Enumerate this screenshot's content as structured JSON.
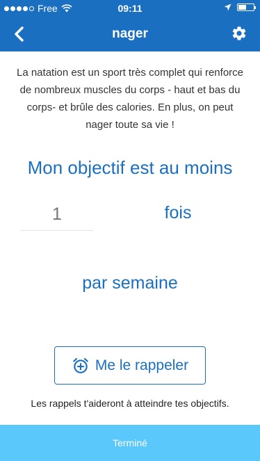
{
  "status_bar": {
    "carrier": "Free",
    "time": "09:11",
    "signal_icon": "signal-dots-icon",
    "wifi_icon": "wifi-icon",
    "location_icon": "location-arrow-icon",
    "battery_icon": "battery-icon",
    "battery_level": 0.55
  },
  "nav": {
    "title": "nager",
    "back_icon": "chevron-left-icon",
    "settings_icon": "gear-icon"
  },
  "description": "La natation est un sport très complet qui renforce de nombreux muscles du corps - haut et bas du corps- et brûle des calories. En plus, on peut nager toute sa vie !",
  "goal": {
    "prefix": "Mon objectif est au moins",
    "count_placeholder": "1",
    "unit": "fois",
    "period": "par semaine"
  },
  "reminder": {
    "label": "Me le rappeler",
    "icon": "alarm-add-icon",
    "hint": "Les rappels t'aideront à atteindre tes objectifs."
  },
  "footer": {
    "done_label": "Terminé"
  },
  "colors": {
    "primary": "#1a6fc1",
    "done_button": "#5ac8fa"
  }
}
